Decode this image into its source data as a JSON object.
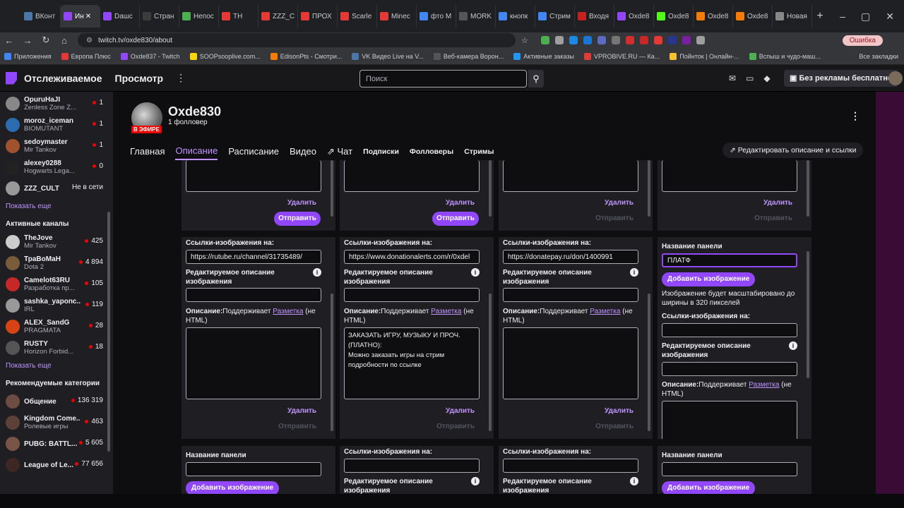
{
  "browser": {
    "tabs": [
      {
        "label": "ВКонт",
        "color": "#4a76a8"
      },
      {
        "label": "Ин",
        "color": "#9147ff",
        "active": true
      },
      {
        "label": "Dашс",
        "color": "#9147ff"
      },
      {
        "label": "Стран",
        "color": "#3c3c3c"
      },
      {
        "label": "Непос",
        "color": "#4caf50"
      },
      {
        "label": "ТН",
        "color": "#e53935"
      },
      {
        "label": "ZZZ_C",
        "color": "#e53935"
      },
      {
        "label": "ПРОХ",
        "color": "#e53935"
      },
      {
        "label": "Scarle",
        "color": "#e53935"
      },
      {
        "label": "Minec",
        "color": "#e53935"
      },
      {
        "label": "фто М",
        "color": "#4285f4"
      },
      {
        "label": "MORK",
        "color": "#555"
      },
      {
        "label": "кнопк",
        "color": "#4285f4"
      },
      {
        "label": "Стрим",
        "color": "#4285f4"
      },
      {
        "label": "Входя",
        "color": "#c5221f"
      },
      {
        "label": "Oxde8",
        "color": "#9147ff"
      },
      {
        "label": "Oxde8",
        "color": "#53fc18"
      },
      {
        "label": "Oxde8",
        "color": "#f57c00"
      },
      {
        "label": "Oxde8",
        "color": "#f57c00"
      },
      {
        "label": "Новая",
        "color": "#888"
      }
    ],
    "close_tab": "✕",
    "new_tab": "+",
    "url": "twitch.tv/oxde830/about",
    "error_label": "Ошибка",
    "bookmarks": [
      {
        "label": "Приложения",
        "color": "#4285f4"
      },
      {
        "label": "Европа Плюс",
        "color": "#e53935"
      },
      {
        "label": "Oxde837 - Twitch",
        "color": "#9147ff"
      },
      {
        "label": "SOOPsooplive.com...",
        "color": "#ffd600"
      },
      {
        "label": "EdisonPts - Смотри...",
        "color": "#f57c00"
      },
      {
        "label": "VK Видео Live на V...",
        "color": "#4a76a8"
      },
      {
        "label": "Веб-камера Ворон...",
        "color": "#555"
      },
      {
        "label": "Активные заказы",
        "color": "#2196f3"
      },
      {
        "label": "VPROBIVE.RU — Ка...",
        "color": "#e53935"
      },
      {
        "label": "Пойнток | Онлайн-...",
        "color": "#fbc02d"
      },
      {
        "label": "Вспыш и чудо-маш...",
        "color": "#4caf50"
      }
    ],
    "all_bookmarks": "Все закладки"
  },
  "twitch": {
    "nav_following": "Отслеживаемое",
    "nav_browse": "Просмотр",
    "nav_more": "⋮",
    "search_placeholder": "Поиск",
    "turbo_label": "Без рекламы бесплатно"
  },
  "sidebar": {
    "followed": [
      {
        "name": "OpuruHaJI",
        "game": "Zenless Zone Z...",
        "viewers": "1",
        "color": "#888"
      },
      {
        "name": "moroz_iceman",
        "game": "BIOMUTANT",
        "viewers": "1",
        "color": "#2b6cb0"
      },
      {
        "name": "sedoymaster",
        "game": "Mir Tankov",
        "viewers": "1",
        "color": "#a0522d"
      },
      {
        "name": "alexey0288",
        "game": "Hogwarts Lega...",
        "viewers": "0",
        "color": "#222"
      },
      {
        "name": "ZZZ_CULT",
        "game": "",
        "viewers": "Не в сети",
        "color": "#999",
        "offline": true
      }
    ],
    "show_more": "Показать еще",
    "active_heading": "Активные каналы",
    "active": [
      {
        "name": "TheJove",
        "game": "Mir Tankov",
        "viewers": "425",
        "color": "#ccc"
      },
      {
        "name": "ТраВоМаН",
        "game": "Dota 2",
        "viewers": "4 894",
        "color": "#7a5c3a"
      },
      {
        "name": "Camelot63RU",
        "game": "Разработка пр...",
        "viewers": "105",
        "color": "#c62828"
      },
      {
        "name": "sashka_yaponc...",
        "game": "IRL",
        "viewers": "119",
        "color": "#999"
      },
      {
        "name": "ALEX_SandG",
        "game": "PRAGMATA",
        "viewers": "28",
        "color": "#d84315"
      },
      {
        "name": "RUSTY",
        "game": "Horizon Forbid...",
        "viewers": "18",
        "color": "#555"
      }
    ],
    "show_more2": "Показать еще",
    "rec_heading": "Рекомендуемые категории",
    "categories": [
      {
        "name": "Общение",
        "game": "",
        "viewers": "136 319",
        "color": "#6d4c41"
      },
      {
        "name": "Kingdom Come...",
        "game": "Ролевые игры",
        "viewers": "463",
        "color": "#5d4037"
      },
      {
        "name": "PUBG: BATTL...",
        "game": "",
        "viewers": "5 605",
        "color": "#795548"
      },
      {
        "name": "League of Le...",
        "game": "",
        "viewers": "77 656",
        "color": "#3e2723"
      }
    ]
  },
  "profile": {
    "name": "Oxde830",
    "followers": "1 фолловер",
    "live": "В ЭФИРЕ",
    "tabs": [
      "Главная",
      "Описание",
      "Расписание",
      "Видео"
    ],
    "tab_chat": "Чат",
    "tabs_small": [
      "Подписки",
      "Фолловеры",
      "Стримы"
    ],
    "edit_label": "Редактировать описание и ссылки"
  },
  "panels": {
    "delete": "Удалить",
    "send": "Отправить",
    "links_label": "Ссылки-изображения на:",
    "alt_label": "Редактируемое описание изображения",
    "desc_label": "Описание:",
    "desc_support": "Поддерживает",
    "markup": "Разметка",
    "desc_tail": "(не HTML)",
    "title_label": "Название панели",
    "add_image": "Добавить изображение",
    "scale_note": "Изображение будет масштабировано до ширины в 320 пикселей",
    "mid": [
      {
        "link": "https://rutube.ru/channel/31735489/",
        "desc": ""
      },
      {
        "link": "https://www.donationalerts.com/r/0xdel",
        "desc": "ЗАКАЗАТЬ ИГРУ, МУЗЫКУ И ПРОЧ. (ПЛАТНО):\nМожно заказать игры на стрим подробности по ссылке"
      },
      {
        "link": "https://donatepay.ru/don/1400991",
        "desc": ""
      }
    ],
    "new_title_value": "ПЛАТФ"
  }
}
